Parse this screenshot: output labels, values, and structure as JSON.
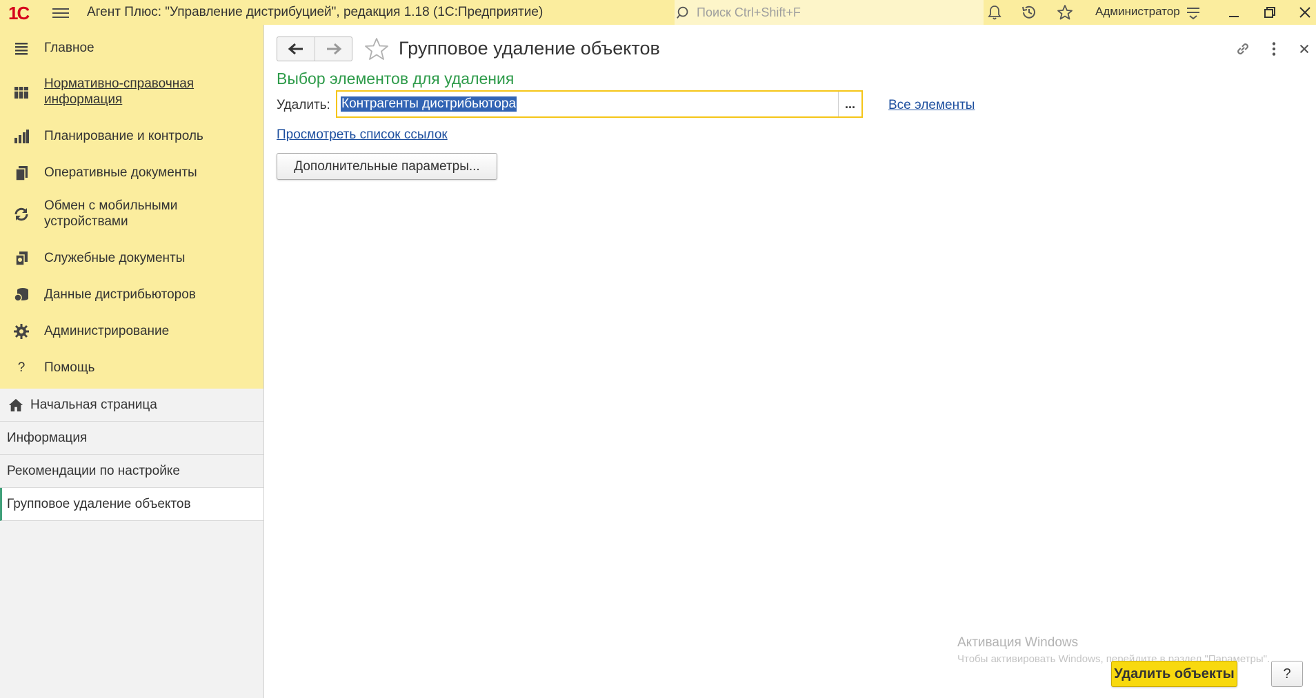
{
  "titlebar": {
    "logo": "1С",
    "app_title": "Агент Плюс: \"Управление дистрибуцией\", редакция 1.18  (1С:Предприятие)",
    "search_placeholder": "Поиск Ctrl+Shift+F",
    "user_name": "Администратор"
  },
  "sidebar": {
    "nav_items": [
      {
        "label": "Главное",
        "icon": "menu-lines-icon"
      },
      {
        "label": "Нормативно-справочная информация",
        "icon": "catalog-icon"
      },
      {
        "label": "Планирование и контроль",
        "icon": "bar-chart-icon"
      },
      {
        "label": "Оперативные документы",
        "icon": "documents-icon"
      },
      {
        "label": "Обмен с мобильными устройствами",
        "icon": "sync-icon"
      },
      {
        "label": "Служебные документы",
        "icon": "service-docs-icon"
      },
      {
        "label": "Данные дистрибьюторов",
        "icon": "database-icon"
      },
      {
        "label": "Администрирование",
        "icon": "gear-icon"
      },
      {
        "label": "Помощь",
        "icon": "help-icon"
      }
    ],
    "open_items": [
      {
        "label": "Начальная страница"
      },
      {
        "label": "Информация"
      },
      {
        "label": "Рекомендации по настройке"
      },
      {
        "label": "Групповое удаление объектов"
      }
    ]
  },
  "form": {
    "title": "Групповое удаление объектов",
    "section_title": "Выбор элементов для удаления",
    "delete_label": "Удалить:",
    "delete_value": "Контрагенты дистрибьютора",
    "select_button": "...",
    "all_elements_link": "Все элементы",
    "view_refs_link": "Просмотреть список ссылок",
    "extra_params_button": "Дополнительные параметры...",
    "delete_objects_button": "Удалить объекты",
    "help_button": "?"
  },
  "watermark": {
    "line1": "Активация Windows",
    "line2": "Чтобы активировать Windows, перейдите в раздел \"Параметры\"."
  },
  "colors": {
    "titlebar_bg": "#fbed9e",
    "section_title": "#2e9b4a",
    "link": "#1c4e9e",
    "primary_button": "#f8d90f",
    "logo": "#d6001c"
  }
}
